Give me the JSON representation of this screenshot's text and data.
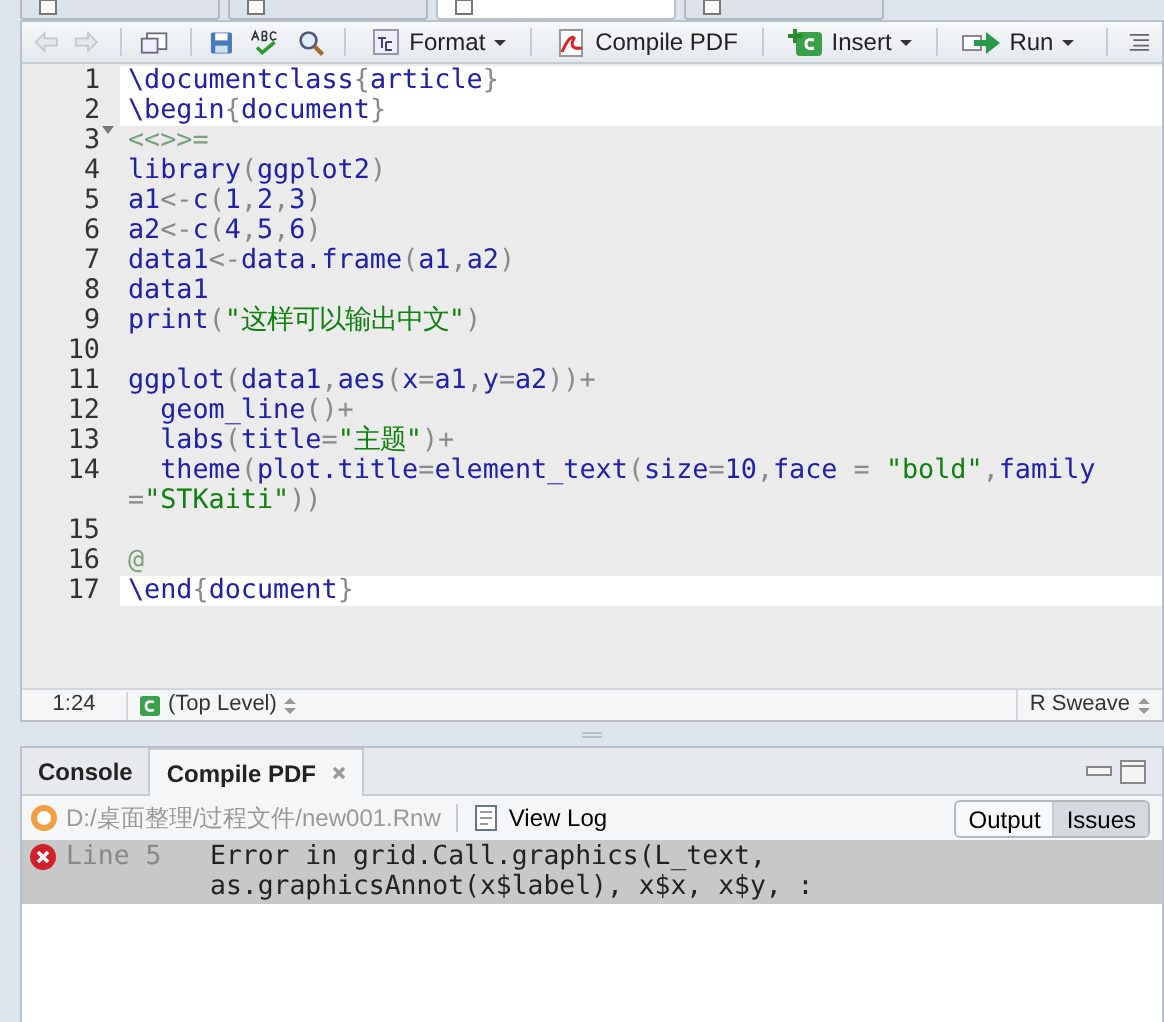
{
  "editor_tabs": [
    {
      "selected": false
    },
    {
      "selected": false
    },
    {
      "selected": true
    },
    {
      "selected": false
    }
  ],
  "toolbar": [
    {
      "kind": "back",
      "disabled": true
    },
    {
      "kind": "forward",
      "disabled": true
    },
    {
      "kind": "popout"
    },
    {
      "kind": "save"
    },
    {
      "kind": "spell"
    },
    {
      "kind": "search"
    },
    {
      "kind": "format",
      "label": "Format",
      "dropdown": true
    },
    {
      "kind": "pdf",
      "label": "Compile PDF"
    },
    {
      "kind": "insert",
      "label": "Insert",
      "dropdown": true
    },
    {
      "kind": "run",
      "label": "Run",
      "dropdown": true
    },
    {
      "kind": "outline"
    }
  ],
  "lines": [
    {
      "number": "1",
      "chunk": false,
      "segments": [
        {
          "kind": "id",
          "text": "\\documentclass"
        },
        {
          "kind": "op",
          "text": "{"
        },
        {
          "kind": "id",
          "text": "article"
        },
        {
          "kind": "op",
          "text": "}"
        }
      ]
    },
    {
      "number": "2",
      "chunk": false,
      "segments": [
        {
          "kind": "id",
          "text": "\\begin"
        },
        {
          "kind": "op",
          "text": "{"
        },
        {
          "kind": "id",
          "text": "document"
        },
        {
          "kind": "op",
          "text": "}"
        }
      ]
    },
    {
      "number": "3",
      "chunk": true,
      "fold": true,
      "segments": [
        {
          "kind": "mark",
          "text": "<<>>="
        }
      ]
    },
    {
      "number": "4",
      "chunk": true,
      "segments": [
        {
          "kind": "id",
          "text": "library"
        },
        {
          "kind": "op",
          "text": "("
        },
        {
          "kind": "id",
          "text": "ggplot2"
        },
        {
          "kind": "op",
          "text": ")"
        }
      ]
    },
    {
      "number": "5",
      "chunk": true,
      "segments": [
        {
          "kind": "id",
          "text": "a1"
        },
        {
          "kind": "op",
          "text": "<-"
        },
        {
          "kind": "id",
          "text": "c"
        },
        {
          "kind": "op",
          "text": "("
        },
        {
          "kind": "num",
          "text": "1"
        },
        {
          "kind": "op",
          "text": ","
        },
        {
          "kind": "num",
          "text": "2"
        },
        {
          "kind": "op",
          "text": ","
        },
        {
          "kind": "num",
          "text": "3"
        },
        {
          "kind": "op",
          "text": ")"
        }
      ]
    },
    {
      "number": "6",
      "chunk": true,
      "segments": [
        {
          "kind": "id",
          "text": "a2"
        },
        {
          "kind": "op",
          "text": "<-"
        },
        {
          "kind": "id",
          "text": "c"
        },
        {
          "kind": "op",
          "text": "("
        },
        {
          "kind": "num",
          "text": "4"
        },
        {
          "kind": "op",
          "text": ","
        },
        {
          "kind": "num",
          "text": "5"
        },
        {
          "kind": "op",
          "text": ","
        },
        {
          "kind": "num",
          "text": "6"
        },
        {
          "kind": "op",
          "text": ")"
        }
      ]
    },
    {
      "number": "7",
      "chunk": true,
      "segments": [
        {
          "kind": "id",
          "text": "data1"
        },
        {
          "kind": "op",
          "text": "<-"
        },
        {
          "kind": "id",
          "text": "data.frame"
        },
        {
          "kind": "op",
          "text": "("
        },
        {
          "kind": "id",
          "text": "a1"
        },
        {
          "kind": "op",
          "text": ","
        },
        {
          "kind": "id",
          "text": "a2"
        },
        {
          "kind": "op",
          "text": ")"
        }
      ]
    },
    {
      "number": "8",
      "chunk": true,
      "segments": [
        {
          "kind": "id",
          "text": "data1"
        }
      ]
    },
    {
      "number": "9",
      "chunk": true,
      "segments": [
        {
          "kind": "id",
          "text": "print"
        },
        {
          "kind": "op",
          "text": "("
        },
        {
          "kind": "str",
          "text": "\"这样可以输出中文\""
        },
        {
          "kind": "op",
          "text": ")"
        }
      ]
    },
    {
      "number": "10",
      "chunk": true
    },
    {
      "number": "11",
      "chunk": true,
      "segments": [
        {
          "kind": "id",
          "text": "ggplot"
        },
        {
          "kind": "op",
          "text": "("
        },
        {
          "kind": "id",
          "text": "data1"
        },
        {
          "kind": "op",
          "text": ","
        },
        {
          "kind": "id",
          "text": "aes"
        },
        {
          "kind": "op",
          "text": "("
        },
        {
          "kind": "id",
          "text": "x"
        },
        {
          "kind": "op",
          "text": "="
        },
        {
          "kind": "id",
          "text": "a1"
        },
        {
          "kind": "op",
          "text": ","
        },
        {
          "kind": "id",
          "text": "y"
        },
        {
          "kind": "op",
          "text": "="
        },
        {
          "kind": "id",
          "text": "a2"
        },
        {
          "kind": "op",
          "text": "))+"
        }
      ]
    },
    {
      "number": "12",
      "chunk": true,
      "segments": [
        {
          "kind": "id",
          "text": "  geom_line"
        },
        {
          "kind": "op",
          "text": "()+"
        }
      ]
    },
    {
      "number": "13",
      "chunk": true,
      "segments": [
        {
          "kind": "id",
          "text": "  labs"
        },
        {
          "kind": "op",
          "text": "("
        },
        {
          "kind": "id",
          "text": "title"
        },
        {
          "kind": "op",
          "text": "="
        },
        {
          "kind": "str",
          "text": "\"主题\""
        },
        {
          "kind": "op",
          "text": ")+"
        }
      ]
    },
    {
      "number": "14",
      "chunk": true,
      "segments": [
        {
          "kind": "id",
          "text": "  theme"
        },
        {
          "kind": "op",
          "text": "("
        },
        {
          "kind": "id",
          "text": "plot.title"
        },
        {
          "kind": "op",
          "text": "="
        },
        {
          "kind": "id",
          "text": "element_text"
        },
        {
          "kind": "op",
          "text": "("
        },
        {
          "kind": "id",
          "text": "size"
        },
        {
          "kind": "op",
          "text": "="
        },
        {
          "kind": "num",
          "text": "10"
        },
        {
          "kind": "op",
          "text": ","
        },
        {
          "kind": "id",
          "text": "face"
        },
        {
          "kind": "op",
          "text": " = "
        },
        {
          "kind": "str",
          "text": "\"bold\""
        },
        {
          "kind": "op",
          "text": ","
        },
        {
          "kind": "id",
          "text": "family"
        },
        {
          "kind": "op",
          "text": "="
        },
        {
          "kind": "str",
          "text": "\"STKaiti\""
        },
        {
          "kind": "op",
          "text": "))"
        }
      ]
    },
    {
      "number": "15",
      "chunk": true
    },
    {
      "number": "16",
      "chunk": true,
      "segments": [
        {
          "kind": "mark",
          "text": "@"
        }
      ]
    },
    {
      "number": "17",
      "chunk": false,
      "segments": [
        {
          "kind": "id",
          "text": "\\end"
        },
        {
          "kind": "op",
          "text": "{"
        },
        {
          "kind": "id",
          "text": "document"
        },
        {
          "kind": "op",
          "text": "}"
        }
      ]
    }
  ],
  "status_bar": {
    "position": "1:24",
    "scope": "(Top Level)",
    "file_type": "R Sweave"
  },
  "bottom_tabs": [
    {
      "label": "Console",
      "selected": false,
      "closable": false
    },
    {
      "label": "Compile PDF",
      "selected": true,
      "closable": true
    }
  ],
  "compile": {
    "path": "D:/桌面整理/过程文件/new001.Rnw",
    "view_log": "View Log",
    "views": [
      {
        "label": "Output",
        "selected": false
      },
      {
        "label": "Issues",
        "selected": true
      }
    ],
    "issues": [
      {
        "line": "Line 5",
        "message": "Error in grid.Call.graphics(L_text, as.graphicsAnnot(x$label), x$x, x$y, :",
        "kind": "error"
      }
    ]
  }
}
